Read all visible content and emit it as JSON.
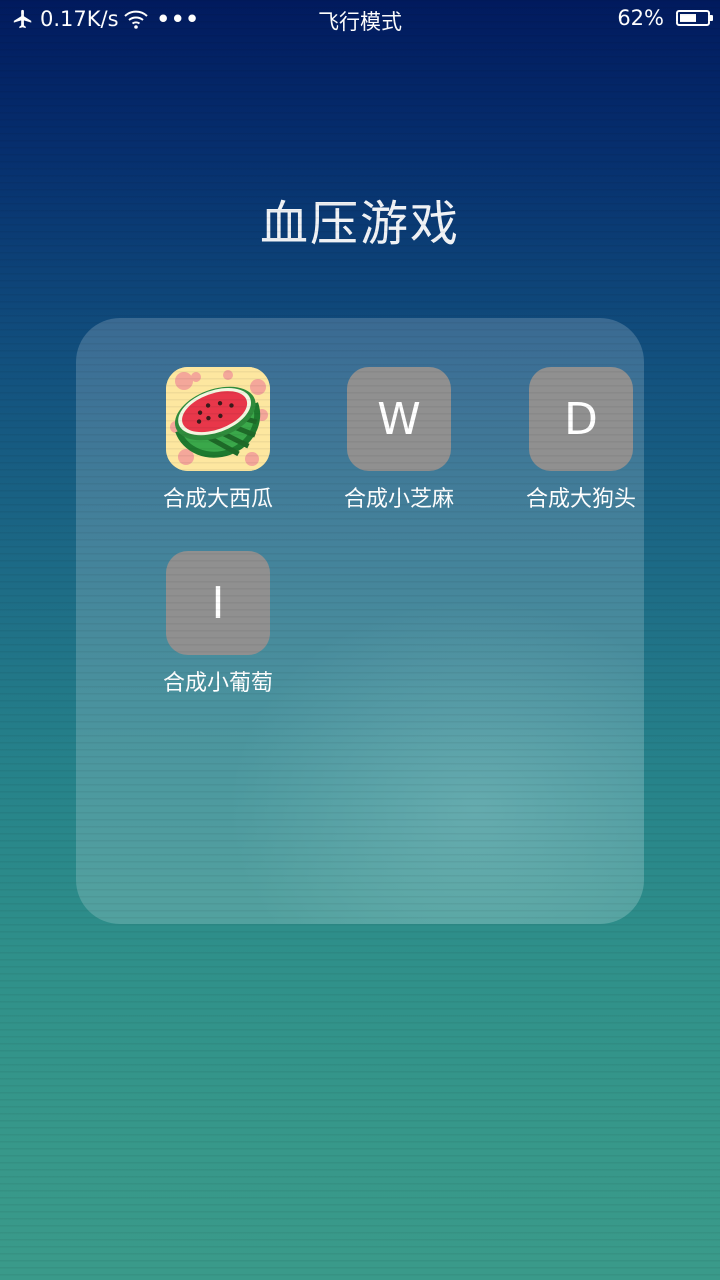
{
  "status_bar": {
    "network_speed": "0.17K/s",
    "more_indicator": "•••",
    "mode": "飞行模式",
    "battery_percent": "62%",
    "battery_level": 0.62,
    "icons": [
      "airplane-icon",
      "wifi-icon",
      "battery-icon"
    ]
  },
  "folder": {
    "title": "血压游戏",
    "apps": [
      {
        "label": "合成大西瓜",
        "icon": "watermelon-icon",
        "icon_letter": ""
      },
      {
        "label": "合成小芝麻",
        "icon": "letter-icon",
        "icon_letter": "W"
      },
      {
        "label": "合成大狗头",
        "icon": "letter-icon",
        "icon_letter": "D"
      },
      {
        "label": "合成小葡萄",
        "icon": "letter-icon",
        "icon_letter": "I"
      }
    ]
  },
  "colors": {
    "placeholder_icon_bg": "#909090",
    "folder_bg": "rgba(255,255,255,0.18)",
    "watermelon_bg": "#fde7a0"
  }
}
